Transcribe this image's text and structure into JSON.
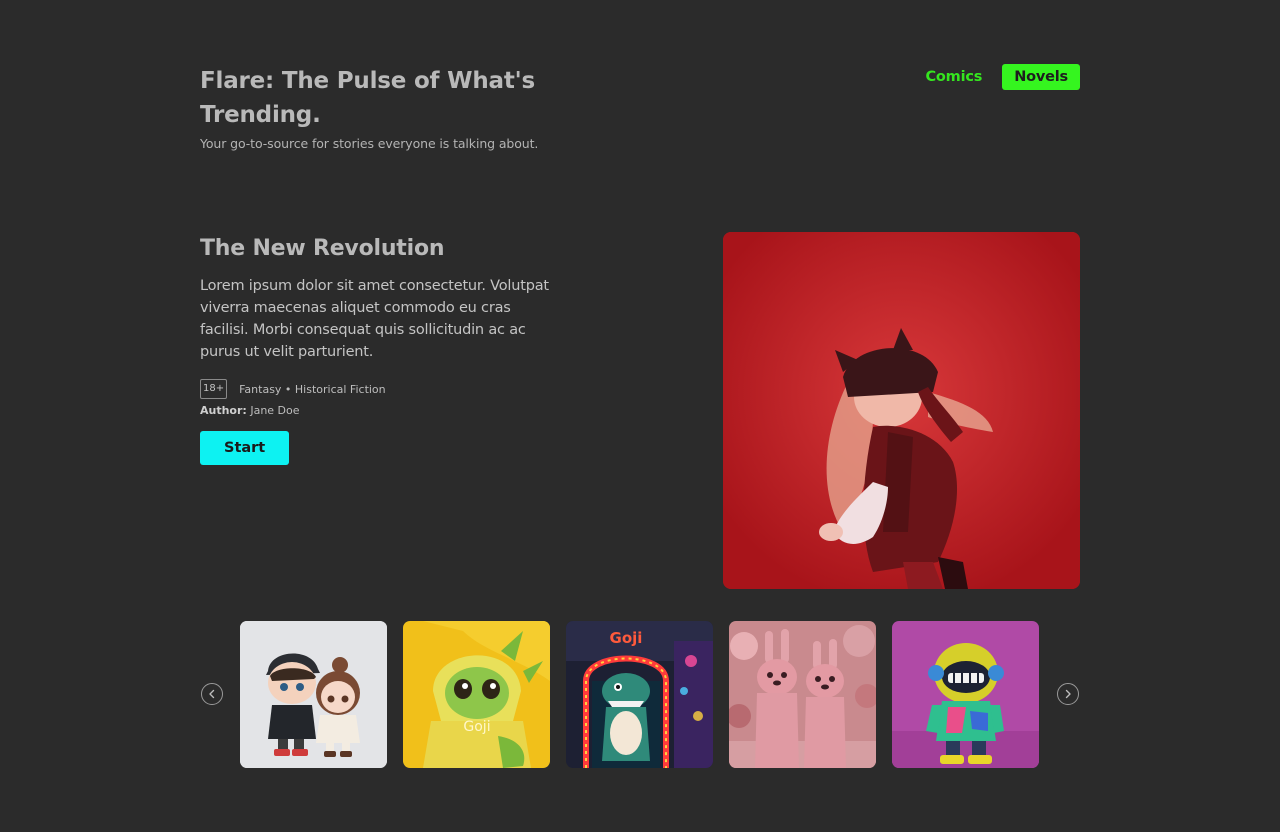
{
  "header": {
    "title": "Flare: The Pulse of What's Trending.",
    "subtitle": "Your go-to-source for stories everyone is talking about."
  },
  "nav": {
    "comics": "Comics",
    "novels": "Novels",
    "active": "Novels",
    "accent": "#35f51f"
  },
  "featured": {
    "title": "The New Revolution",
    "description": "Lorem ipsum dolor sit amet consectetur. Volutpat viverra maecenas aliquet commodo eu cras facilisi. Morbi consequat quis sollicitudin ac ac purus ut velit parturient.",
    "rating": "18+",
    "genres": "Fantasy • Historical Fiction",
    "author_label": "Author:",
    "author": "Jane Doe",
    "cta": "Start",
    "cta_color": "#0df2f2"
  },
  "carousel": {
    "prev_icon": "chevron-left-icon",
    "next_icon": "chevron-right-icon",
    "items": [
      {
        "name": "chibi-couple"
      },
      {
        "name": "dragon-hoodie",
        "label": "Goji"
      },
      {
        "name": "dino-arcade",
        "label": "Goji"
      },
      {
        "name": "pink-creatures"
      },
      {
        "name": "robot-helmet"
      }
    ]
  }
}
